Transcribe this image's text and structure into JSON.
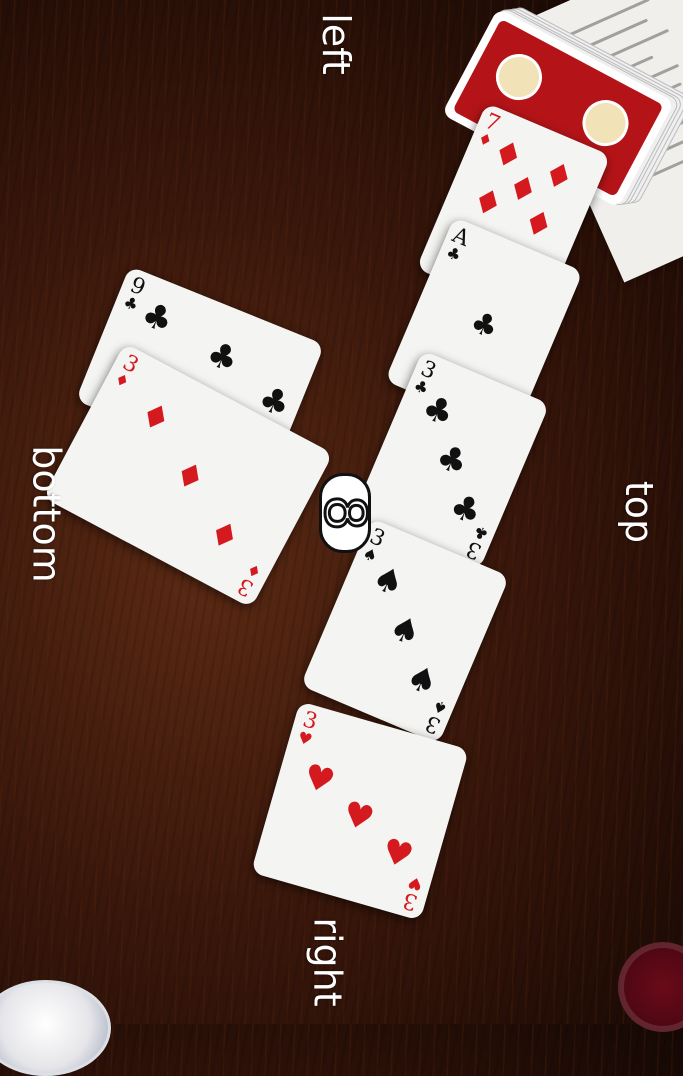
{
  "labels": {
    "left": "left",
    "top": "top",
    "right": "right",
    "bottom": "bottom"
  },
  "counter": "8",
  "cards": {
    "seven_diamonds": {
      "rank": "7",
      "suit": "♦"
    },
    "ace_clubs": {
      "rank": "A",
      "suit": "♣"
    },
    "three_clubs": {
      "rank": "3",
      "suit": "♣"
    },
    "three_spades": {
      "rank": "3",
      "suit": "♠"
    },
    "three_hearts": {
      "rank": "3",
      "suit": "♥"
    },
    "nine_clubs": {
      "rank": "9",
      "suit": "♣"
    },
    "three_diamonds": {
      "rank": "3",
      "suit": "♦"
    }
  },
  "colors": {
    "table": "#3a170b",
    "card": "#f4f4f2",
    "red_suit": "#d41a1f",
    "black_suit": "#111111",
    "deck_back": "#b41418"
  }
}
